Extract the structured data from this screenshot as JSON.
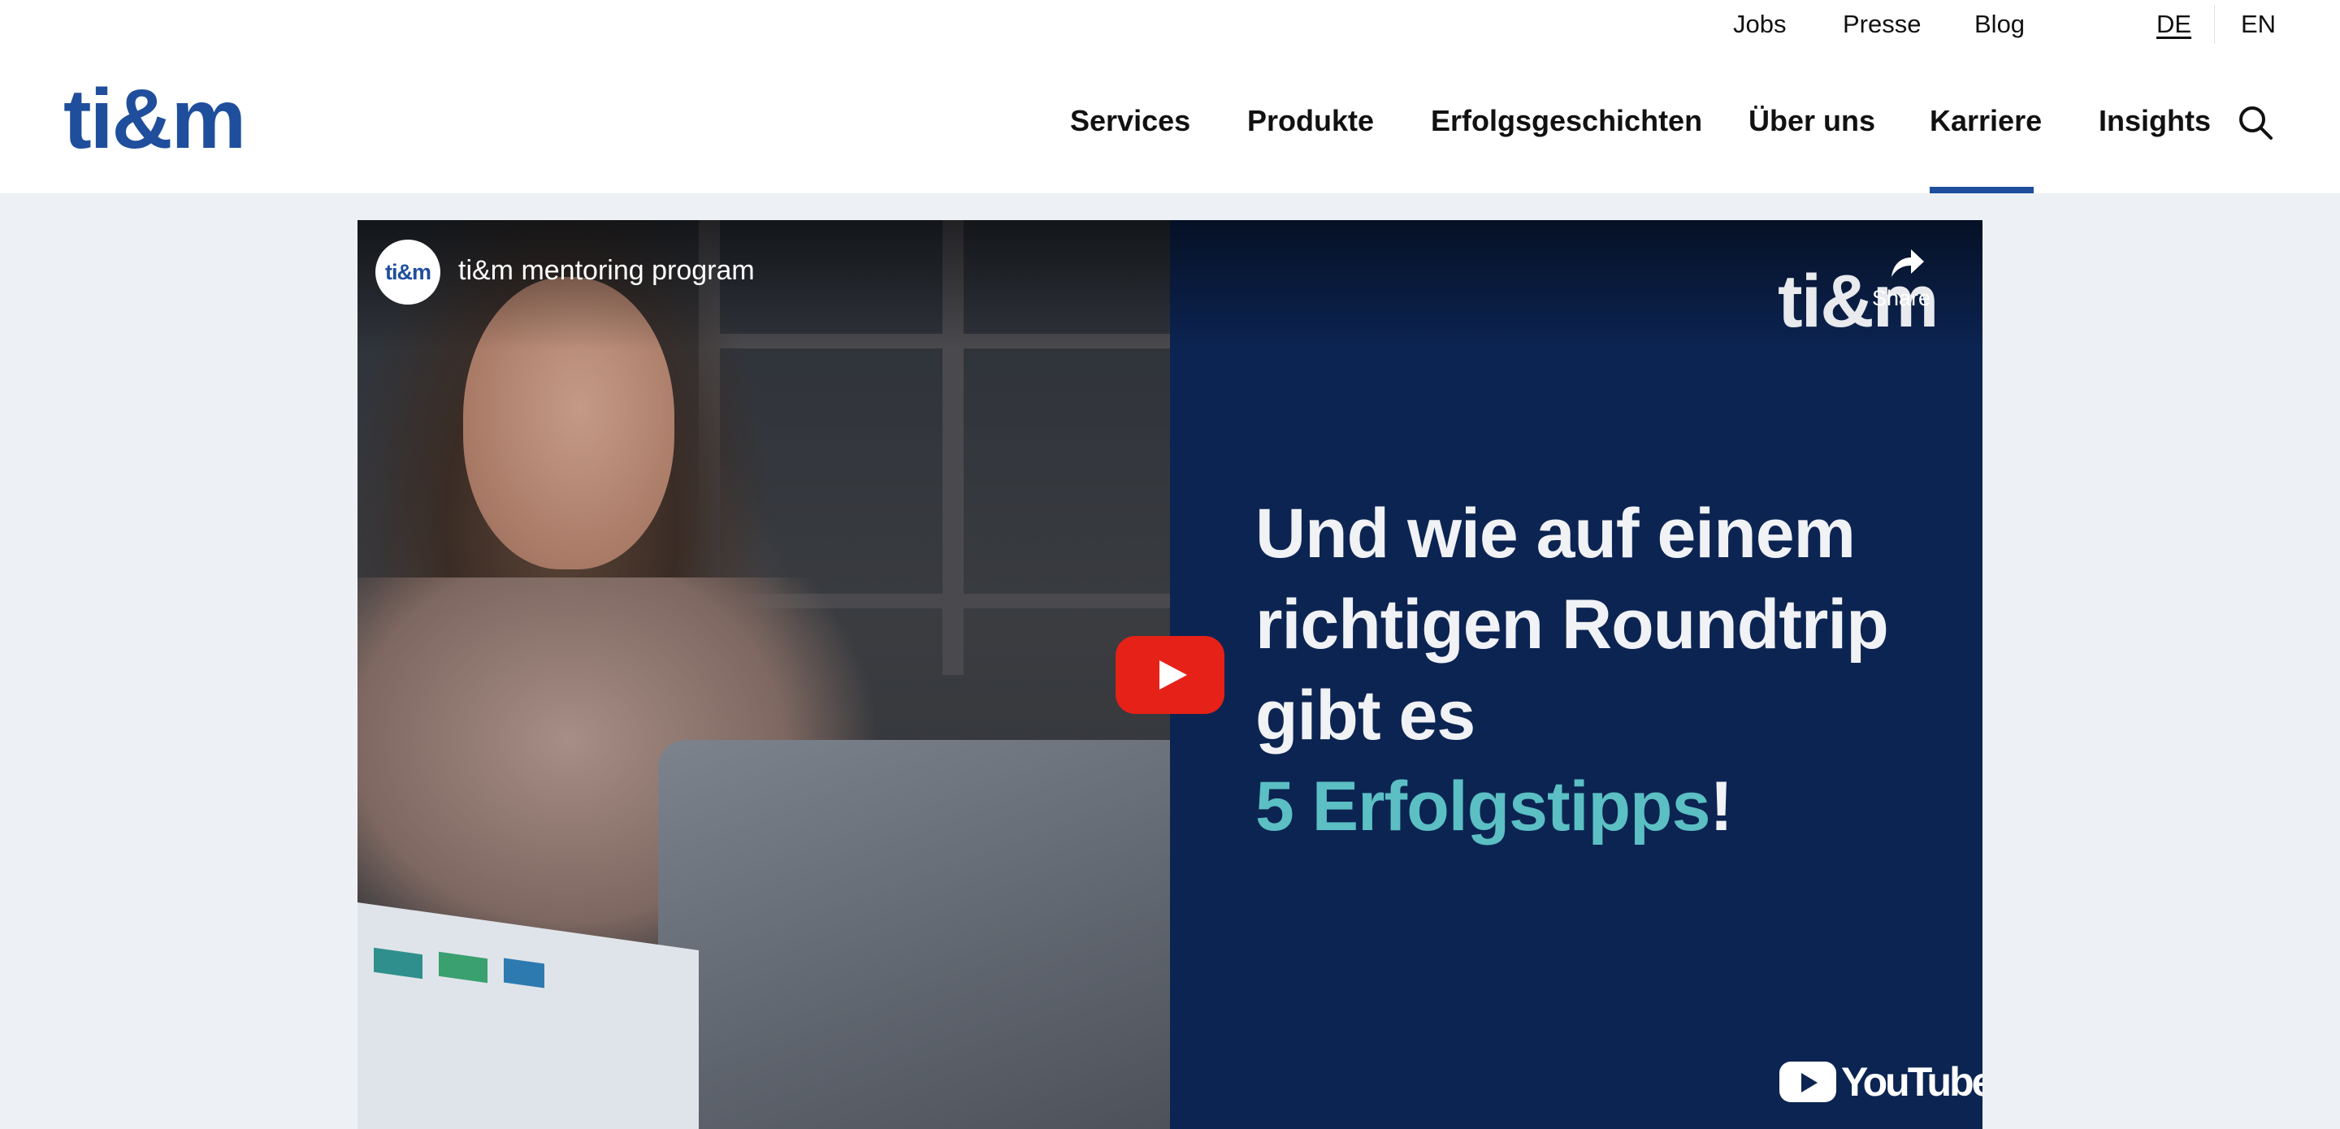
{
  "utility_nav": {
    "jobs": "Jobs",
    "presse": "Presse",
    "blog": "Blog",
    "lang_de": "DE",
    "lang_en": "EN",
    "active_language": "DE"
  },
  "logo": {
    "text": "ti&m",
    "color": "#1f4e9c"
  },
  "main_nav": {
    "services": "Services",
    "produkte": "Produkte",
    "erfolgsgeschichten": "Erfolgsgeschichten",
    "ueber_uns": "Über uns",
    "karriere": "Karriere",
    "insights": "Insights",
    "active_item": "Karriere",
    "search_icon": "search-icon"
  },
  "video": {
    "channel_avatar": "ti&m",
    "title": "ti&m mentoring program",
    "share_label": "Share",
    "brand_watermark": "ti&m",
    "headline_line1": "Und wie auf einem",
    "headline_line2": "richtigen Roundtrip",
    "headline_line3": "gibt es",
    "headline_highlight": "5 Erfolgstipps",
    "headline_end": "!",
    "platform": "YouTube",
    "play_icon": "play-icon",
    "colors": {
      "panel": "#0c2452",
      "highlight": "#5bbfc4",
      "play_button": "#e62117"
    }
  },
  "colors": {
    "brand_blue": "#1f4e9c",
    "page_background": "#edf1f5"
  }
}
